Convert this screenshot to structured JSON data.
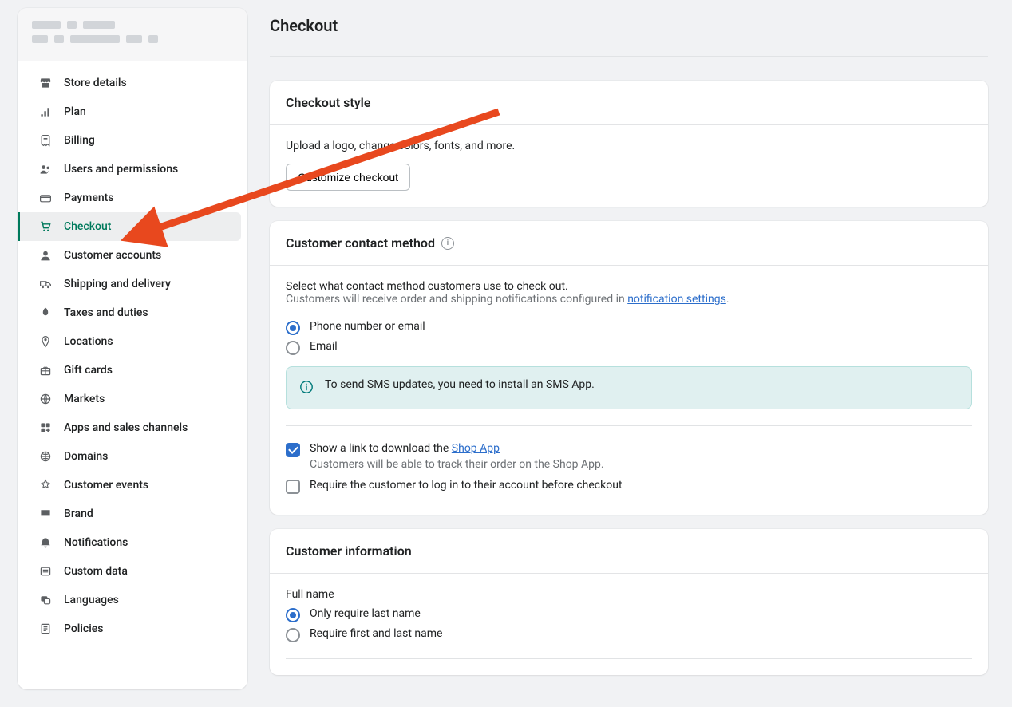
{
  "page": {
    "title": "Checkout"
  },
  "sidebar": {
    "items": [
      {
        "label": "Store details",
        "icon": "store-icon"
      },
      {
        "label": "Plan",
        "icon": "plan-icon"
      },
      {
        "label": "Billing",
        "icon": "billing-icon"
      },
      {
        "label": "Users and permissions",
        "icon": "users-icon"
      },
      {
        "label": "Payments",
        "icon": "payments-icon"
      },
      {
        "label": "Checkout",
        "icon": "cart-icon",
        "active": true
      },
      {
        "label": "Customer accounts",
        "icon": "customer-icon"
      },
      {
        "label": "Shipping and delivery",
        "icon": "shipping-icon"
      },
      {
        "label": "Taxes and duties",
        "icon": "taxes-icon"
      },
      {
        "label": "Locations",
        "icon": "locations-icon"
      },
      {
        "label": "Gift cards",
        "icon": "gift-icon"
      },
      {
        "label": "Markets",
        "icon": "markets-icon"
      },
      {
        "label": "Apps and sales channels",
        "icon": "apps-icon"
      },
      {
        "label": "Domains",
        "icon": "domains-icon"
      },
      {
        "label": "Customer events",
        "icon": "events-icon"
      },
      {
        "label": "Brand",
        "icon": "brand-icon"
      },
      {
        "label": "Notifications",
        "icon": "notifications-icon"
      },
      {
        "label": "Custom data",
        "icon": "customdata-icon"
      },
      {
        "label": "Languages",
        "icon": "languages-icon"
      },
      {
        "label": "Policies",
        "icon": "policies-icon"
      }
    ]
  },
  "checkout_style": {
    "heading": "Checkout style",
    "description": "Upload a logo, change colors, fonts, and more.",
    "button": "Customize checkout"
  },
  "contact_method": {
    "heading": "Customer contact method",
    "intro1": "Select what contact method customers use to check out.",
    "intro2_prefix": "Customers will receive order and shipping notifications configured in ",
    "intro2_link": "notification settings",
    "intro2_suffix": ".",
    "option_phone_email": "Phone number or email",
    "option_email": "Email",
    "banner_prefix": "To send SMS updates, you need to install an ",
    "banner_link": "SMS App",
    "banner_suffix": ".",
    "shop_prefix": "Show a link to download the ",
    "shop_link": "Shop App",
    "shop_help": "Customers will be able to track their order on the Shop App.",
    "require_login": "Require the customer to log in to their account before checkout"
  },
  "customer_info": {
    "heading": "Customer information",
    "fullname_label": "Full name",
    "option_last": "Only require last name",
    "option_first_last": "Require first and last name"
  }
}
